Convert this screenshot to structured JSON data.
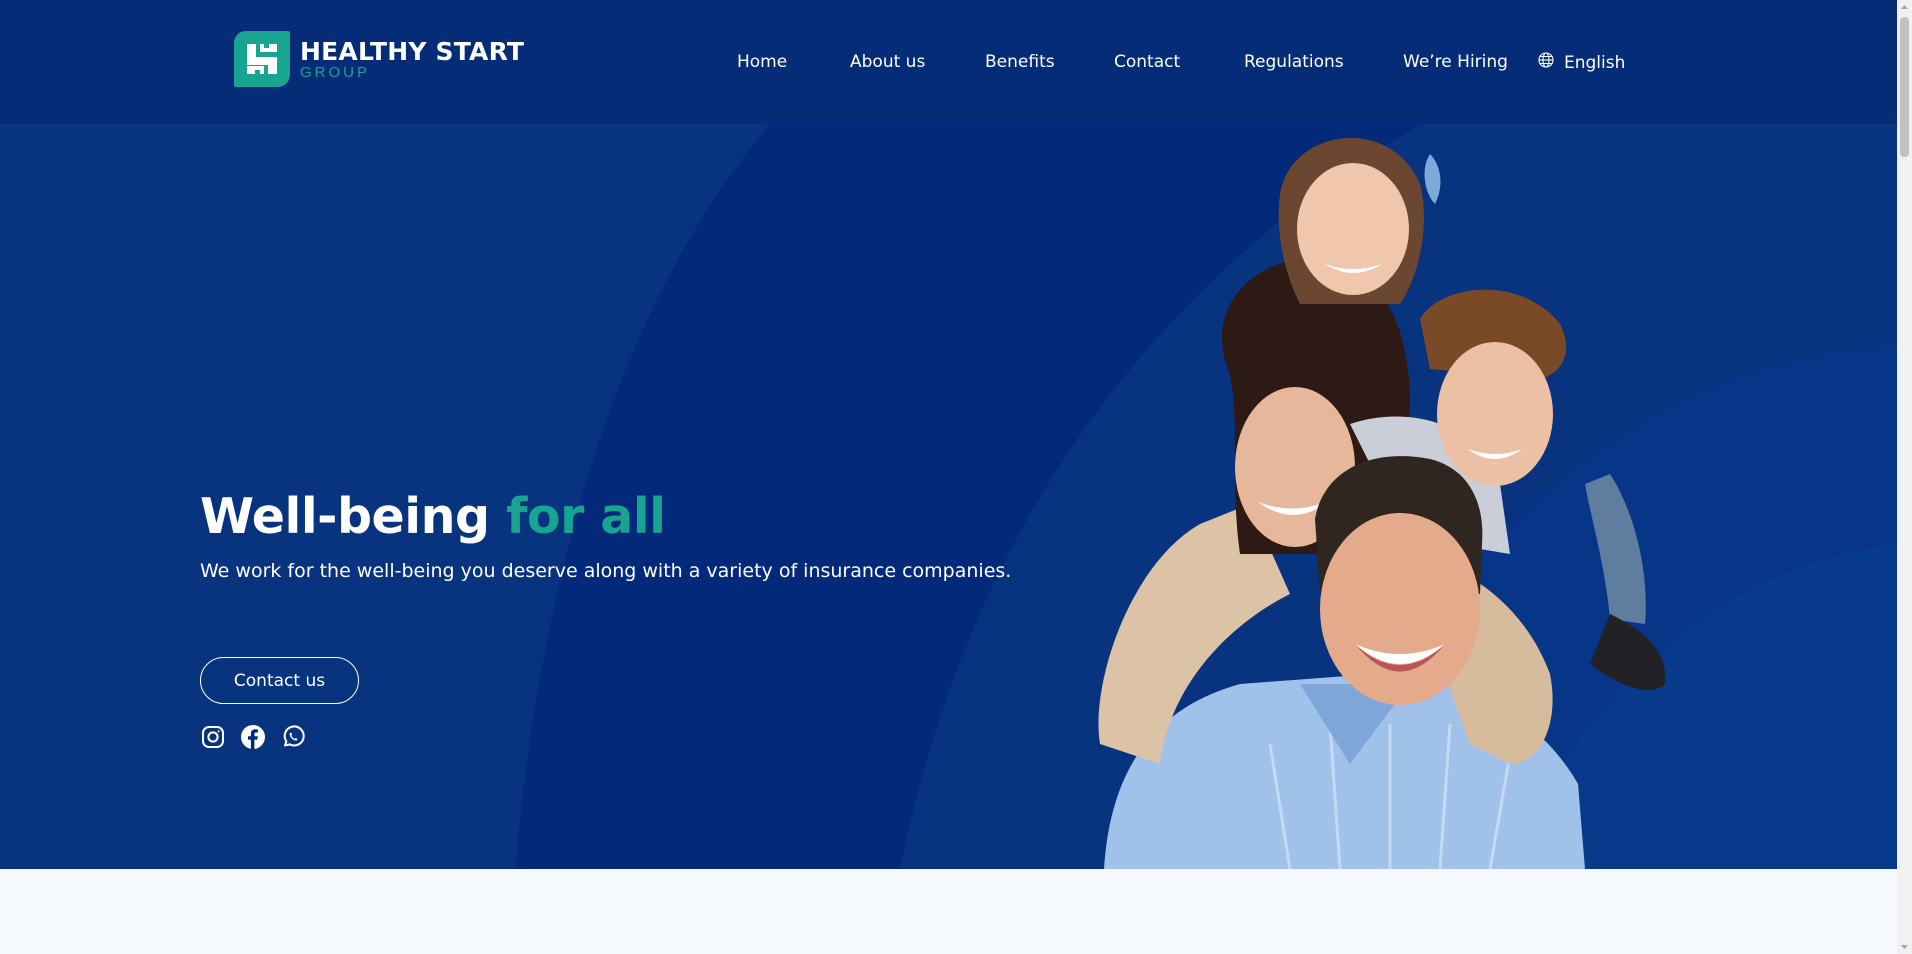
{
  "brand": {
    "name": "HEALTHY START",
    "sub": "GROUP",
    "logo_icon": "hs-monogram-icon"
  },
  "colors": {
    "navy": "#042c77",
    "hero": "#03297a",
    "teal": "#17a491",
    "white": "#ffffff",
    "below_fold": "#f5f8fd"
  },
  "nav": {
    "items": [
      {
        "label": "Home"
      },
      {
        "label": "About us"
      },
      {
        "label": "Benefits"
      },
      {
        "label": "Contact"
      },
      {
        "label": "Regulations"
      },
      {
        "label": "We’re Hiring"
      }
    ],
    "language": {
      "label": "English",
      "icon": "globe-icon"
    }
  },
  "hero": {
    "title_main": "Well-being",
    "title_accent": "for all",
    "subtitle": "We work for the well-being you deserve along with a variety of insurance companies.",
    "cta_label": "Contact us",
    "socials": [
      {
        "icon": "instagram-icon"
      },
      {
        "icon": "facebook-icon"
      },
      {
        "icon": "whatsapp-icon"
      }
    ],
    "image": "family-photo"
  }
}
